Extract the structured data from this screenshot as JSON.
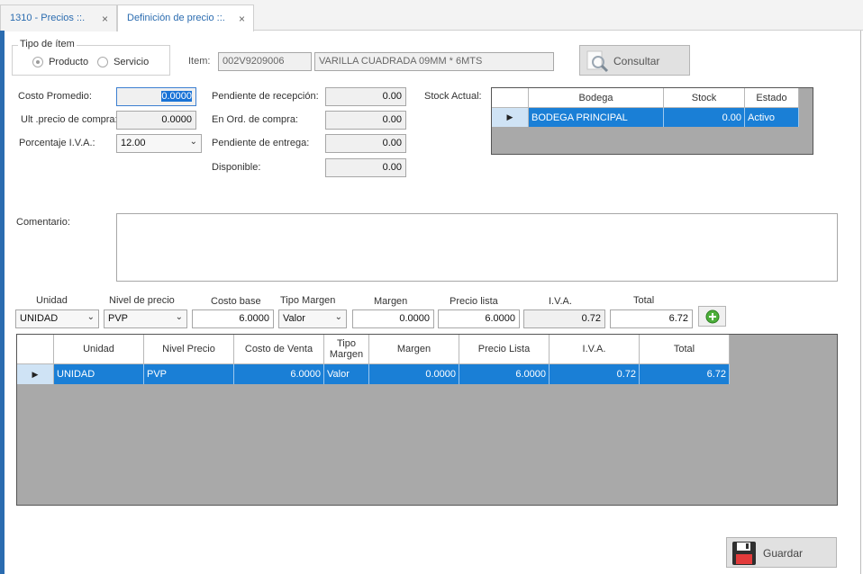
{
  "tabs": [
    {
      "label": "1310 - Precios ::.",
      "close": "×"
    },
    {
      "label": "Definición de precio ::.",
      "close": "×"
    }
  ],
  "tipo_item": {
    "title": "Tipo de ítem",
    "options": [
      "Producto",
      "Servicio"
    ],
    "selected": "Producto"
  },
  "item": {
    "label": "Item:",
    "code": "002V9209006",
    "description": "VARILLA CUADRADA 09MM * 6MTS"
  },
  "consultar_label": "Consultar",
  "costos": {
    "costo_promedio_label": "Costo Promedio:",
    "costo_promedio": "0.0000",
    "ult_precio_label": "Ult .precio de compra:",
    "ult_precio": "0.0000",
    "iva_label": "Porcentaje I.V.A.:",
    "iva": "12.00"
  },
  "pendientes": {
    "recepcion_label": "Pendiente de recepción:",
    "recepcion": "0.00",
    "orden_label": "En Ord. de compra:",
    "orden": "0.00",
    "entrega_label": "Pendiente de entrega:",
    "entrega": "0.00",
    "disponible_label": "Disponible:",
    "disponible": "0.00"
  },
  "stock": {
    "label": "Stock Actual:",
    "headers": [
      "Bodega",
      "Stock",
      "Estado"
    ],
    "rows": [
      {
        "bodega": "BODEGA PRINCIPAL",
        "stock": "0.00",
        "estado": "Activo"
      }
    ]
  },
  "comentario_label": "Comentario:",
  "entry": {
    "headers": [
      "Unidad",
      "Nivel de precio",
      "Costo base",
      "Tipo Margen",
      "Margen",
      "Precio lista",
      "I.V.A.",
      "Total"
    ],
    "unidad": "UNIDAD",
    "nivel": "PVP",
    "costo_base": "6.0000",
    "tipo_margen": "Valor",
    "margen": "0.0000",
    "precio_lista": "6.0000",
    "iva": "0.72",
    "total": "6.72"
  },
  "precios_grid": {
    "headers": [
      "Unidad",
      "Nivel Precio",
      "Costo de Venta",
      "Tipo Margen",
      "Margen",
      "Precio Lista",
      "I.V.A.",
      "Total"
    ],
    "rows": [
      {
        "unidad": "UNIDAD",
        "nivel": "PVP",
        "costo_venta": "6.0000",
        "tipo_margen": "Valor",
        "margen": "0.0000",
        "precio_lista": "6.0000",
        "iva": "0.72",
        "total": "6.72"
      }
    ]
  },
  "guardar_label": "Guardar",
  "colors": {
    "accent": "#2b6cb0",
    "selection": "#1a7fd6",
    "grid_bg": "#a9a9a9"
  }
}
